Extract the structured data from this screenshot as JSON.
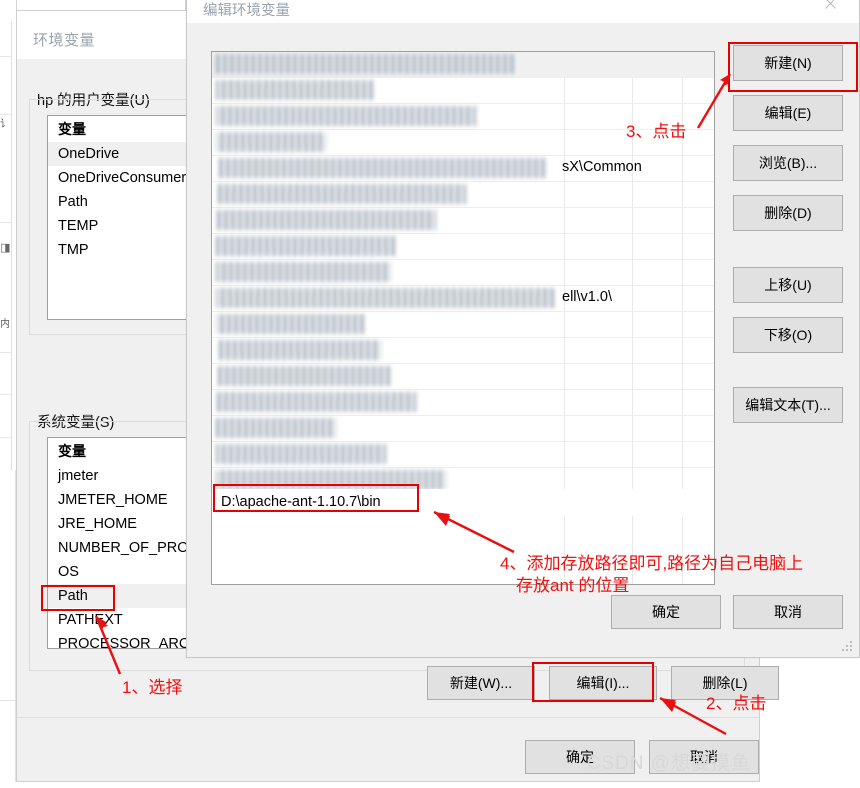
{
  "background_window": {
    "title": "环境变量",
    "user_vars": {
      "group_label": "hp 的用户变量(U)",
      "column_header": "变量",
      "rows": [
        "OneDrive",
        "OneDriveConsumer",
        "Path",
        "TEMP",
        "TMP"
      ]
    },
    "system_vars": {
      "group_label": "系统变量(S)",
      "column_header": "变量",
      "rows": [
        "jmeter",
        "JMETER_HOME",
        "JRE_HOME",
        "NUMBER_OF_PROC",
        "OS",
        "Path",
        "PATHEXT",
        "PROCESSOR_ARCH"
      ],
      "selected_row": "Path"
    },
    "sys_buttons": {
      "new": "新建(W)...",
      "edit": "编辑(I)...",
      "delete": "删除(L)"
    },
    "dialog_buttons": {
      "ok": "确定",
      "cancel": "取消"
    }
  },
  "edit_dialog": {
    "title": "编辑环境变量",
    "close_icon": "close-icon",
    "path_entries": [
      {
        "visible_text": "",
        "fragment": "",
        "blurred": true
      },
      {
        "visible_text": "",
        "fragment": "",
        "blurred": true
      },
      {
        "visible_text": "",
        "fragment": "",
        "blurred": true
      },
      {
        "visible_text": "",
        "fragment": "",
        "blurred": true
      },
      {
        "visible_text": "",
        "fragment": "sX\\Common",
        "blurred": true
      },
      {
        "visible_text": "",
        "fragment": "",
        "blurred": true
      },
      {
        "visible_text": "",
        "fragment": "",
        "blurred": true
      },
      {
        "visible_text": "",
        "fragment": "",
        "blurred": true
      },
      {
        "visible_text": "",
        "fragment": "",
        "blurred": true
      },
      {
        "visible_text": "",
        "fragment": "ell\\v1.0\\",
        "blurred": true
      },
      {
        "visible_text": "",
        "fragment": "",
        "blurred": true
      },
      {
        "visible_text": "",
        "fragment": "",
        "blurred": true
      },
      {
        "visible_text": "",
        "fragment": "",
        "blurred": true
      },
      {
        "visible_text": "",
        "fragment": "",
        "blurred": true
      },
      {
        "visible_text": "",
        "fragment": "",
        "blurred": true
      },
      {
        "visible_text": "",
        "fragment": "",
        "blurred": true
      },
      {
        "visible_text": "",
        "fragment": "",
        "blurred": true
      }
    ],
    "new_entry_value": "D:\\apache-ant-1.10.7\\bin",
    "side_buttons": {
      "new": "新建(N)",
      "edit": "编辑(E)",
      "browse": "浏览(B)...",
      "delete": "删除(D)",
      "move_up": "上移(U)",
      "move_down": "下移(O)",
      "edit_text": "编辑文本(T)..."
    },
    "dialog_buttons": {
      "ok": "确定",
      "cancel": "取消"
    }
  },
  "annotations": {
    "step1": "1、选择",
    "step2": "2、点击",
    "step3": "3、点击",
    "step4_line1": "4、添加存放路径即可,路径为自己电脑上",
    "step4_line2": "存放ant 的位置"
  },
  "watermark": "CSDN @想要摸鱼",
  "colors": {
    "annotation_red": "#f01010",
    "highlight_box": "#e60000",
    "dialog_bg": "#f0f0f0",
    "button_bg": "#e1e1e1",
    "title_gray": "#9aa3ad"
  }
}
